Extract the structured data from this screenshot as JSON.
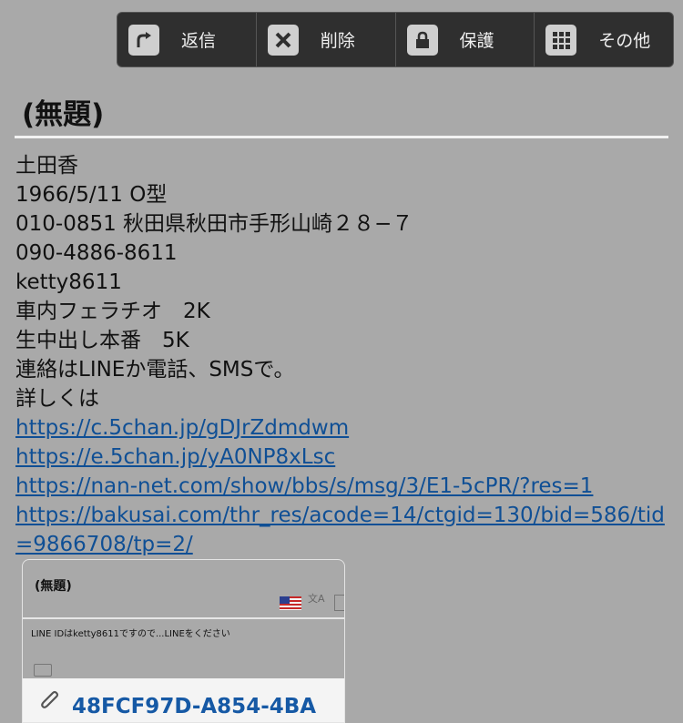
{
  "toolbar": {
    "reply": "返信",
    "delete": "削除",
    "protect": "保護",
    "more": "その他"
  },
  "message": {
    "title": "(無題)",
    "lines": [
      "土田香",
      "1966/5/11 O型",
      "010-0851 秋田県秋田市手形山崎２８−７",
      "090-4886-8611",
      "ketty8611",
      "車内フェラチオ　2K",
      "生中出し本番　5K",
      "連絡はLINEか電話、SMSで。",
      "詳しくは"
    ],
    "links": [
      "https://c.5chan.jp/gDJrZdmdwm",
      "https://e.5chan.jp/yA0NP8xLsc",
      "https://nan-net.com/show/bbs/s/msg/3/E1-5cPR/?res=1",
      "https://bakusai.com/thr_res/acode=14/ctgid=130/bid=586/tid",
      "=9866708/tp=2/"
    ]
  },
  "preview": {
    "title": "(無題)",
    "translate_glyph": "文A",
    "body": "LINE IDはketty8611ですので...LINEをください",
    "attachment": "48FCF97D-A854-4BA"
  }
}
